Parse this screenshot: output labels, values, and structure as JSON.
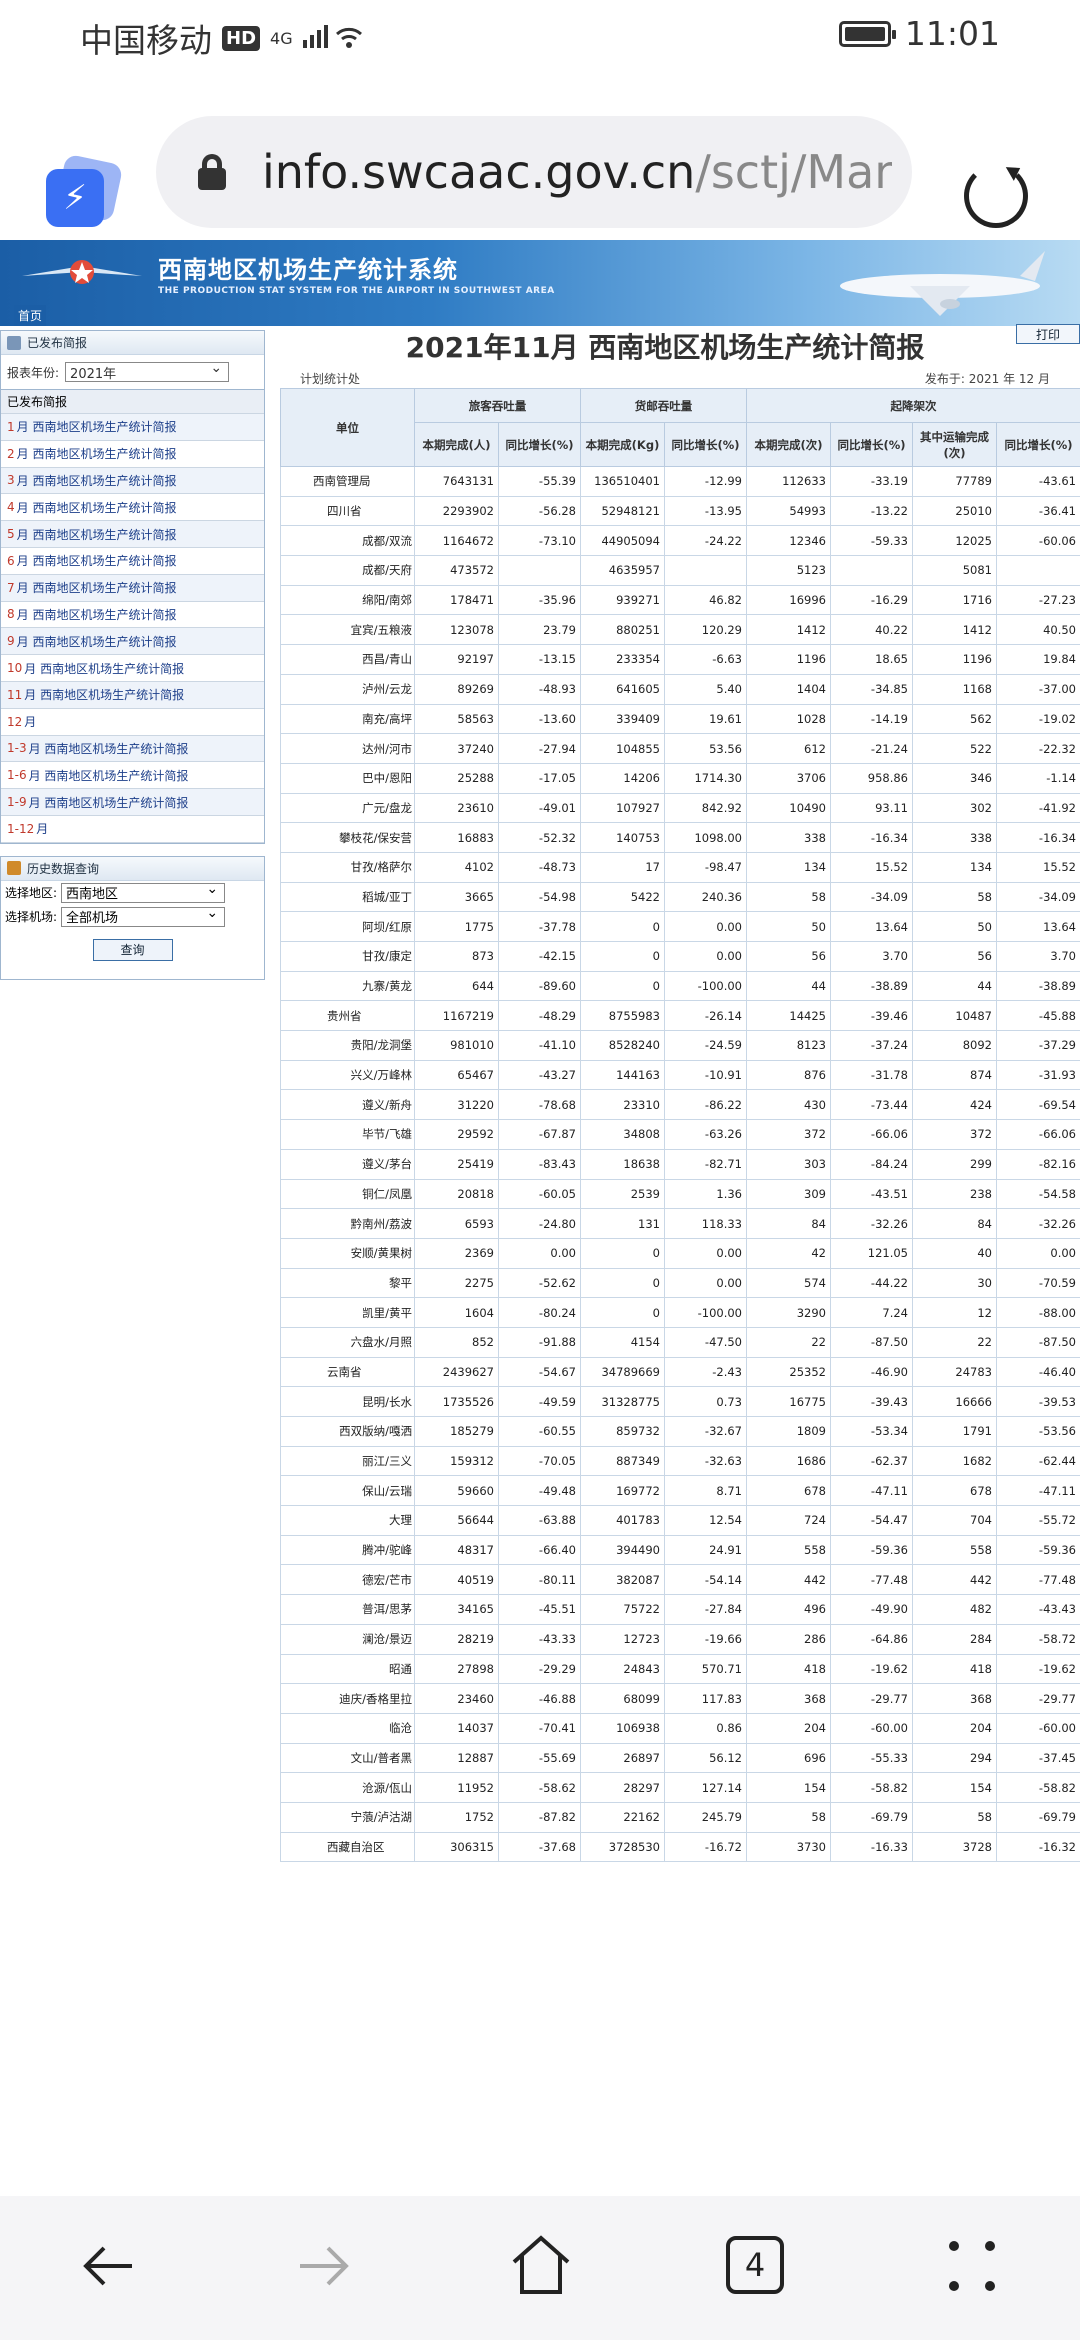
{
  "status": {
    "carrier": "中国移动",
    "hd": "HD",
    "net": "4G",
    "time": "11:01"
  },
  "browser": {
    "url_host": "info.swcaac.gov.cn",
    "url_path": "/sctj/Man",
    "tabs": "4"
  },
  "banner": {
    "title": "西南地区机场生产统计系统",
    "subtitle": "THE PRODUCTION STAT SYSTEM FOR THE AIRPORT IN SOUTHWEST AREA",
    "home": "首页"
  },
  "left": {
    "published_title": "已发布简报",
    "year_label": "报表年份:",
    "year_value": "2021年",
    "list_header": "已发布简报",
    "months": [
      {
        "m": "1",
        "label": "月 西南地区机场生产统计简报"
      },
      {
        "m": "2",
        "label": "月 西南地区机场生产统计简报"
      },
      {
        "m": "3",
        "label": "月 西南地区机场生产统计简报"
      },
      {
        "m": "4",
        "label": "月 西南地区机场生产统计简报"
      },
      {
        "m": "5",
        "label": "月 西南地区机场生产统计简报"
      },
      {
        "m": "6",
        "label": "月 西南地区机场生产统计简报"
      },
      {
        "m": "7",
        "label": "月 西南地区机场生产统计简报"
      },
      {
        "m": "8",
        "label": "月 西南地区机场生产统计简报"
      },
      {
        "m": "9",
        "label": "月 西南地区机场生产统计简报"
      },
      {
        "m": "10",
        "label": "月 西南地区机场生产统计简报"
      },
      {
        "m": "11",
        "label": "月 西南地区机场生产统计简报"
      },
      {
        "m": "12",
        "label": "月"
      },
      {
        "m": "1-3",
        "label": "月 西南地区机场生产统计简报"
      },
      {
        "m": "1-6",
        "label": "月 西南地区机场生产统计简报"
      },
      {
        "m": "1-9",
        "label": "月 西南地区机场生产统计简报"
      },
      {
        "m": "1-12",
        "label": "月"
      }
    ],
    "history_title": "历史数据查询",
    "region_label": "选择地区:",
    "region_value": "西南地区",
    "airport_label": "选择机场:",
    "airport_value": "全部机场",
    "query_btn": "查询"
  },
  "report": {
    "title": "2021年11月 西南地区机场生产统计简报",
    "print": "打印",
    "dept": "计划统计处",
    "published": "发布于: 2021 年 12 月",
    "headers": {
      "unit": "单位",
      "g1": "旅客吞吐量",
      "g2": "货邮吞吐量",
      "g3": "起降架次",
      "c1": "本期完成(人)",
      "c2": "同比增长(%)",
      "c3": "本期完成(Kg)",
      "c4": "同比增长(%)",
      "c5": "本期完成(次)",
      "c6": "同比增长(%)",
      "c7": "其中运输完成(次)",
      "c8": "同比增长(%)"
    },
    "rows": [
      {
        "t": "gen",
        "u": "西南管理局",
        "v": [
          "7643131",
          "-55.39",
          "136510401",
          "-12.99",
          "112633",
          "-33.19",
          "77789",
          "-43.61"
        ]
      },
      {
        "t": "prov",
        "u": "四川省",
        "v": [
          "2293902",
          "-56.28",
          "52948121",
          "-13.95",
          "54993",
          "-13.22",
          "25010",
          "-36.41"
        ]
      },
      {
        "t": "a",
        "u": "成都/双流",
        "v": [
          "1164672",
          "-73.10",
          "44905094",
          "-24.22",
          "12346",
          "-59.33",
          "12025",
          "-60.06"
        ]
      },
      {
        "t": "a",
        "u": "成都/天府",
        "v": [
          "473572",
          "",
          "4635957",
          "",
          "5123",
          "",
          "5081",
          ""
        ]
      },
      {
        "t": "a",
        "u": "绵阳/南郊",
        "v": [
          "178471",
          "-35.96",
          "939271",
          "46.82",
          "16996",
          "-16.29",
          "1716",
          "-27.23"
        ]
      },
      {
        "t": "a",
        "u": "宜宾/五粮液",
        "v": [
          "123078",
          "23.79",
          "880251",
          "120.29",
          "1412",
          "40.22",
          "1412",
          "40.50"
        ]
      },
      {
        "t": "a",
        "u": "西昌/青山",
        "v": [
          "92197",
          "-13.15",
          "233354",
          "-6.63",
          "1196",
          "18.65",
          "1196",
          "19.84"
        ]
      },
      {
        "t": "a",
        "u": "泸州/云龙",
        "v": [
          "89269",
          "-48.93",
          "641605",
          "5.40",
          "1404",
          "-34.85",
          "1168",
          "-37.00"
        ]
      },
      {
        "t": "a",
        "u": "南充/高坪",
        "v": [
          "58563",
          "-13.60",
          "339409",
          "19.61",
          "1028",
          "-14.19",
          "562",
          "-19.02"
        ]
      },
      {
        "t": "a",
        "u": "达州/河市",
        "v": [
          "37240",
          "-27.94",
          "104855",
          "53.56",
          "612",
          "-21.24",
          "522",
          "-22.32"
        ]
      },
      {
        "t": "a",
        "u": "巴中/恩阳",
        "v": [
          "25288",
          "-17.05",
          "14206",
          "1714.30",
          "3706",
          "958.86",
          "346",
          "-1.14"
        ]
      },
      {
        "t": "a",
        "u": "广元/盘龙",
        "v": [
          "23610",
          "-49.01",
          "107927",
          "842.92",
          "10490",
          "93.11",
          "302",
          "-41.92"
        ]
      },
      {
        "t": "a",
        "u": "攀枝花/保安营",
        "v": [
          "16883",
          "-52.32",
          "140753",
          "1098.00",
          "338",
          "-16.34",
          "338",
          "-16.34"
        ]
      },
      {
        "t": "a",
        "u": "甘孜/格萨尔",
        "v": [
          "4102",
          "-48.73",
          "17",
          "-98.47",
          "134",
          "15.52",
          "134",
          "15.52"
        ]
      },
      {
        "t": "a",
        "u": "稻城/亚丁",
        "v": [
          "3665",
          "-54.98",
          "5422",
          "240.36",
          "58",
          "-34.09",
          "58",
          "-34.09"
        ]
      },
      {
        "t": "a",
        "u": "阿坝/红原",
        "v": [
          "1775",
          "-37.78",
          "0",
          "0.00",
          "50",
          "13.64",
          "50",
          "13.64"
        ]
      },
      {
        "t": "a",
        "u": "甘孜/康定",
        "v": [
          "873",
          "-42.15",
          "0",
          "0.00",
          "56",
          "3.70",
          "56",
          "3.70"
        ]
      },
      {
        "t": "a",
        "u": "九寨/黄龙",
        "v": [
          "644",
          "-89.60",
          "0",
          "-100.00",
          "44",
          "-38.89",
          "44",
          "-38.89"
        ]
      },
      {
        "t": "prov",
        "u": "贵州省",
        "v": [
          "1167219",
          "-48.29",
          "8755983",
          "-26.14",
          "14425",
          "-39.46",
          "10487",
          "-45.88"
        ]
      },
      {
        "t": "a",
        "u": "贵阳/龙洞堡",
        "v": [
          "981010",
          "-41.10",
          "8528240",
          "-24.59",
          "8123",
          "-37.24",
          "8092",
          "-37.29"
        ]
      },
      {
        "t": "a",
        "u": "兴义/万峰林",
        "v": [
          "65467",
          "-43.27",
          "144163",
          "-10.91",
          "876",
          "-31.78",
          "874",
          "-31.93"
        ]
      },
      {
        "t": "a",
        "u": "遵义/新舟",
        "v": [
          "31220",
          "-78.68",
          "23310",
          "-86.22",
          "430",
          "-73.44",
          "424",
          "-69.54"
        ]
      },
      {
        "t": "a",
        "u": "毕节/飞雄",
        "v": [
          "29592",
          "-67.87",
          "34808",
          "-63.26",
          "372",
          "-66.06",
          "372",
          "-66.06"
        ]
      },
      {
        "t": "a",
        "u": "遵义/茅台",
        "v": [
          "25419",
          "-83.43",
          "18638",
          "-82.71",
          "303",
          "-84.24",
          "299",
          "-82.16"
        ]
      },
      {
        "t": "a",
        "u": "铜仁/凤凰",
        "v": [
          "20818",
          "-60.05",
          "2539",
          "1.36",
          "309",
          "-43.51",
          "238",
          "-54.58"
        ]
      },
      {
        "t": "a",
        "u": "黔南州/荔波",
        "v": [
          "6593",
          "-24.80",
          "131",
          "118.33",
          "84",
          "-32.26",
          "84",
          "-32.26"
        ]
      },
      {
        "t": "a",
        "u": "安顺/黄果树",
        "v": [
          "2369",
          "0.00",
          "0",
          "0.00",
          "42",
          "121.05",
          "40",
          "0.00"
        ]
      },
      {
        "t": "a",
        "u": "黎平",
        "v": [
          "2275",
          "-52.62",
          "0",
          "0.00",
          "574",
          "-44.22",
          "30",
          "-70.59"
        ]
      },
      {
        "t": "a",
        "u": "凯里/黄平",
        "v": [
          "1604",
          "-80.24",
          "0",
          "-100.00",
          "3290",
          "7.24",
          "12",
          "-88.00"
        ]
      },
      {
        "t": "a",
        "u": "六盘水/月照",
        "v": [
          "852",
          "-91.88",
          "4154",
          "-47.50",
          "22",
          "-87.50",
          "22",
          "-87.50"
        ]
      },
      {
        "t": "prov",
        "u": "云南省",
        "v": [
          "2439627",
          "-54.67",
          "34789669",
          "-2.43",
          "25352",
          "-46.90",
          "24783",
          "-46.40"
        ]
      },
      {
        "t": "a",
        "u": "昆明/长水",
        "v": [
          "1735526",
          "-49.59",
          "31328775",
          "0.73",
          "16775",
          "-39.43",
          "16666",
          "-39.53"
        ]
      },
      {
        "t": "a",
        "u": "西双版纳/嘎洒",
        "v": [
          "185279",
          "-60.55",
          "859732",
          "-32.67",
          "1809",
          "-53.34",
          "1791",
          "-53.56"
        ]
      },
      {
        "t": "a",
        "u": "丽江/三义",
        "v": [
          "159312",
          "-70.05",
          "887349",
          "-32.63",
          "1686",
          "-62.37",
          "1682",
          "-62.44"
        ]
      },
      {
        "t": "a",
        "u": "保山/云瑞",
        "v": [
          "59660",
          "-49.48",
          "169772",
          "8.71",
          "678",
          "-47.11",
          "678",
          "-47.11"
        ]
      },
      {
        "t": "a",
        "u": "大理",
        "v": [
          "56644",
          "-63.88",
          "401783",
          "12.54",
          "724",
          "-54.47",
          "704",
          "-55.72"
        ]
      },
      {
        "t": "a",
        "u": "腾冲/驼峰",
        "v": [
          "48317",
          "-66.40",
          "394490",
          "24.91",
          "558",
          "-59.36",
          "558",
          "-59.36"
        ]
      },
      {
        "t": "a",
        "u": "德宏/芒市",
        "v": [
          "40519",
          "-80.11",
          "382087",
          "-54.14",
          "442",
          "-77.48",
          "442",
          "-77.48"
        ]
      },
      {
        "t": "a",
        "u": "普洱/思茅",
        "v": [
          "34165",
          "-45.51",
          "75722",
          "-27.84",
          "496",
          "-49.90",
          "482",
          "-43.43"
        ]
      },
      {
        "t": "a",
        "u": "澜沧/景迈",
        "v": [
          "28219",
          "-43.33",
          "12723",
          "-19.66",
          "286",
          "-64.86",
          "284",
          "-58.72"
        ]
      },
      {
        "t": "a",
        "u": "昭通",
        "v": [
          "27898",
          "-29.29",
          "24843",
          "570.71",
          "418",
          "-19.62",
          "418",
          "-19.62"
        ]
      },
      {
        "t": "a",
        "u": "迪庆/香格里拉",
        "v": [
          "23460",
          "-46.88",
          "68099",
          "117.83",
          "368",
          "-29.77",
          "368",
          "-29.77"
        ]
      },
      {
        "t": "a",
        "u": "临沧",
        "v": [
          "14037",
          "-70.41",
          "106938",
          "0.86",
          "204",
          "-60.00",
          "204",
          "-60.00"
        ]
      },
      {
        "t": "a",
        "u": "文山/普者黑",
        "v": [
          "12887",
          "-55.69",
          "26897",
          "56.12",
          "696",
          "-55.33",
          "294",
          "-37.45"
        ]
      },
      {
        "t": "a",
        "u": "沧源/佤山",
        "v": [
          "11952",
          "-58.62",
          "28297",
          "127.14",
          "154",
          "-58.82",
          "154",
          "-58.82"
        ]
      },
      {
        "t": "a",
        "u": "宁蒗/泸沽湖",
        "v": [
          "1752",
          "-87.82",
          "22162",
          "245.79",
          "58",
          "-69.79",
          "58",
          "-69.79"
        ]
      },
      {
        "t": "prov",
        "u": "西藏自治区",
        "v": [
          "306315",
          "-37.68",
          "3728530",
          "-16.72",
          "3730",
          "-16.33",
          "3728",
          "-16.32"
        ]
      }
    ]
  }
}
